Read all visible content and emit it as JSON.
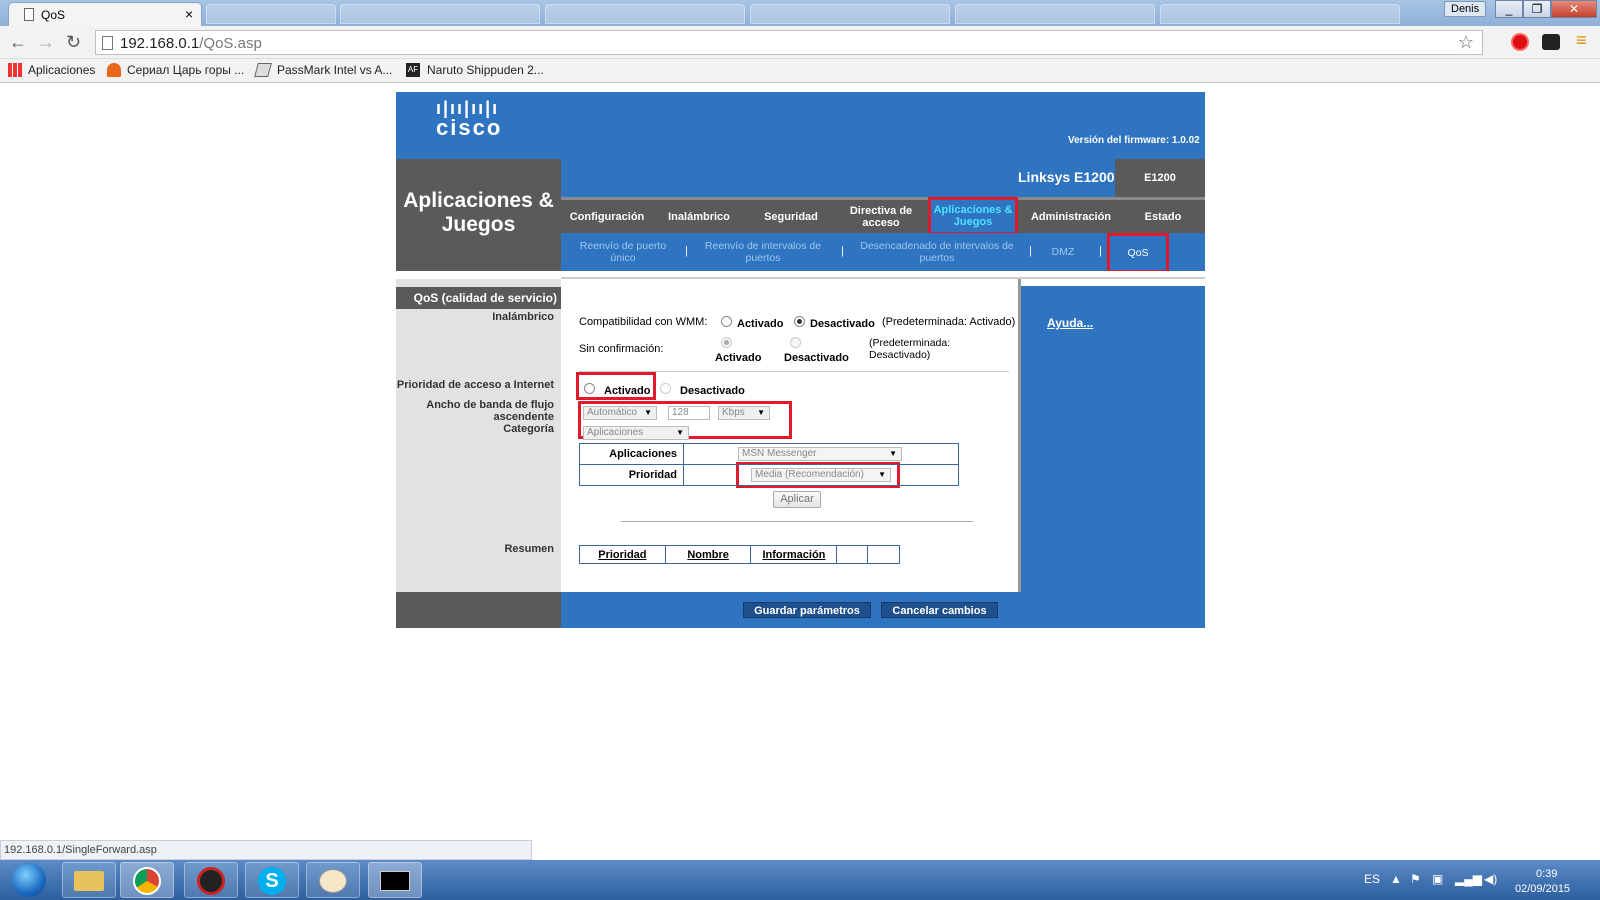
{
  "browser": {
    "tab_title": "QoS",
    "tab_close": "×",
    "user": "Denis",
    "url_host": "192.168.0.1",
    "url_path": "/QoS.asp",
    "bookmarks": [
      {
        "label": "Aplicaciones",
        "icon": "apps-grid-icon"
      },
      {
        "label": "Сериал Царь горы ...",
        "icon": "bookmark-flame-icon"
      },
      {
        "label": "PassMark Intel vs A...",
        "icon": "bookmark-page-icon"
      },
      {
        "label": "Naruto Shippuden 2...",
        "icon": "bookmark-af-icon"
      }
    ],
    "status_url": "192.168.0.1/SingleForward.asp"
  },
  "router": {
    "brand": "cisco",
    "firmware": "Versión del firmware: 1.0.02",
    "section_title": "Aplicaciones & Juegos",
    "model_name": "Linksys E1200",
    "model_short": "E1200",
    "main_nav": [
      "Configuración",
      "Inalámbrico",
      "Seguridad",
      "Directiva de acceso",
      "Aplicaciones & Juegos",
      "Administración",
      "Estado"
    ],
    "main_nav_active": "Aplicaciones & Juegos",
    "sub_nav": [
      "Reenvío de puerto único",
      "Reenvío de intervalos de puertos",
      "Desencadenado de intervalos de puertos",
      "DMZ",
      "QoS"
    ],
    "sub_nav_active": "QoS",
    "left_heading": "QoS (calidad de servicio)",
    "left_labels": {
      "wireless": "Inalámbrico",
      "internet_priority": "Prioridad de acceso a Internet",
      "upstream": "Ancho de banda de flujo ascendente",
      "category": "Categoría",
      "summary": "Resumen"
    },
    "wmm": {
      "label": "Compatibilidad con WMM:",
      "on": "Activado",
      "off": "Desactivado",
      "selected": "Desactivado",
      "default_note": "(Predeterminada: Activado)"
    },
    "no_ack": {
      "label": "Sin confirmación:",
      "on": "Activado",
      "off": "Desactivado",
      "selected": "Activado",
      "default_note": "(Predeterminada: Desactivado)"
    },
    "internet_priority": {
      "on": "Activado",
      "off": "Desactivado",
      "selected": "none"
    },
    "upstream": {
      "mode": "Automático",
      "value": "128",
      "unit": "Kbps"
    },
    "category": "Aplicaciones",
    "app_table": {
      "app_label": "Aplicaciones",
      "app_value": "MSN Messenger",
      "priority_label": "Prioridad",
      "priority_value": "Media (Recomendación)",
      "apply": "Aplicar"
    },
    "summary_headers": [
      "Prioridad",
      "Nombre",
      "Información",
      "",
      ""
    ],
    "help": "Ayuda...",
    "save": "Guardar parámetros",
    "cancel": "Cancelar cambios"
  },
  "taskbar": {
    "lang": "ES",
    "time": "0:39",
    "date": "02/09/2015"
  },
  "colors": {
    "cisco_blue": "#2f74c0",
    "gray": "#5a5a5a",
    "highlight_red": "#e0192d",
    "active_tab_text": "#4ee4ff"
  }
}
